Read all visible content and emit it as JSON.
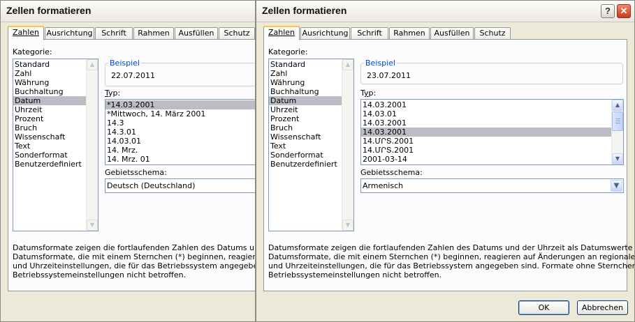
{
  "dialogs": [
    {
      "title": "Zellen formatieren",
      "tabs": [
        "Zahlen",
        "Ausrichtung",
        "Schrift",
        "Rahmen",
        "Ausfüllen",
        "Schutz"
      ],
      "category_label": "Kategorie:",
      "categories": [
        "Standard",
        "Zahl",
        "Währung",
        "Buchhaltung",
        "Datum",
        "Uhrzeit",
        "Prozent",
        "Bruch",
        "Wissenschaft",
        "Text",
        "Sonderformat",
        "Benutzerdefiniert"
      ],
      "selected_category": "Datum",
      "sample_label": "Beispiel",
      "sample_value": "22.07.2011",
      "type_label": "Typ:",
      "types": [
        "*14.03.2001",
        "*Mittwoch, 14. März 2001",
        "14.3",
        "14.3.01",
        "14.03.01",
        "14. Mrz.",
        "14. Mrz. 01"
      ],
      "selected_type": "*14.03.2001",
      "locale_label": "Gebietsschema:",
      "locale_value": "Deutsch (Deutschland)",
      "description": [
        "Datumsformate zeigen die fortlaufenden Zahlen des Datums und der Uhrz",
        "Datumsformate, die mit einem Sternchen (*) beginnen, reagieren auf Änder",
        "und Uhrzeiteinstellungen, die für das Betriebssystem angegeben sind. Fo",
        "Betriebssystemeinstellungen nicht betroffen."
      ]
    },
    {
      "title": "Zellen formatieren",
      "tabs": [
        "Zahlen",
        "Ausrichtung",
        "Schrift",
        "Rahmen",
        "Ausfüllen",
        "Schutz"
      ],
      "category_label": "Kategorie:",
      "categories": [
        "Standard",
        "Zahl",
        "Währung",
        "Buchhaltung",
        "Datum",
        "Uhrzeit",
        "Prozent",
        "Bruch",
        "Wissenschaft",
        "Text",
        "Sonderformat",
        "Benutzerdefiniert"
      ],
      "selected_category": "Datum",
      "sample_label": "Beispiel",
      "sample_value": "23.07.2011",
      "type_label": "Typ:",
      "types": [
        "14.03.2001",
        "14.03.01",
        "14.03.2001",
        "14.03.2001",
        "14.ՄՐՏ.2001",
        "14.ՄՐՏ.2001",
        "2001-03-14"
      ],
      "selected_type_index": 3,
      "locale_label": "Gebietsschema:",
      "locale_value": "Armenisch",
      "description": [
        "Datumsformate zeigen die fortlaufenden Zahlen des Datums und der Uhrzeit als Datumswerte an.",
        "Datumsformate, die mit einem Sternchen (*) beginnen, reagieren auf Änderungen an regionalen Datums-",
        "und Uhrzeiteinstellungen, die für das Betriebssystem angegeben sind. Formate ohne Sternchen sind von",
        "Betriebssystemeinstellungen nicht betroffen."
      ],
      "ok_label": "OK",
      "cancel_label": "Abbrechen",
      "help_glyph": "?",
      "close_glyph": "✕"
    }
  ],
  "colors": {
    "dialog_bg": "#ECE9D8",
    "pane_bg": "#FCFCFE",
    "selection": "#BCBCC4",
    "group_title": "#0046D5",
    "tab_highlight": "#FFC83C",
    "close_button": "#C83B1C"
  },
  "icons": {
    "scroll_up": "▲",
    "scroll_down": "▼",
    "combo_arrow": "▼"
  }
}
